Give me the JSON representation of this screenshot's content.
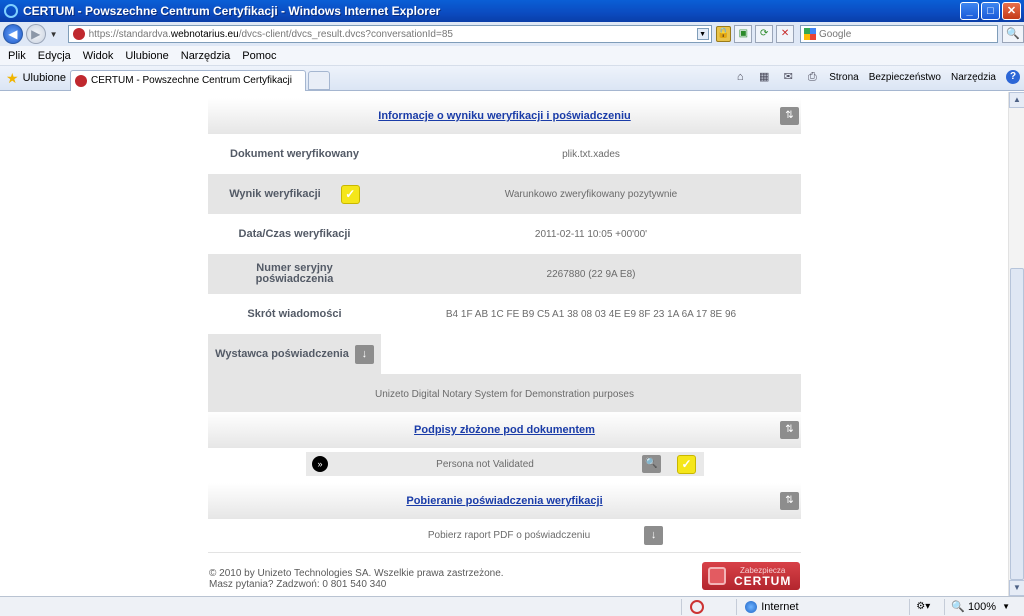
{
  "window": {
    "title": "CERTUM - Powszechne Centrum Certyfikacji - Windows Internet Explorer"
  },
  "address": {
    "url_prefix": "https://standardva.",
    "url_domain": "webnotarius.eu",
    "url_path": "/dvcs-client/dvcs_result.dvcs?conversationId=85",
    "search_placeholder": "Google"
  },
  "menu": [
    "Plik",
    "Edycja",
    "Widok",
    "Ulubione",
    "Narzędzia",
    "Pomoc"
  ],
  "tabs": {
    "favorites_label": "Ulubione",
    "active_tab": "CERTUM - Powszechne Centrum Certyfikacji"
  },
  "commandbar": {
    "page": "Strona",
    "safety": "Bezpieczeństwo",
    "tools": "Narzędzia"
  },
  "verification": {
    "header": "Informacje o wyniku weryfikacji i poświadczeniu",
    "rows": [
      {
        "label": "Dokument weryfikowany",
        "value": "plik.txt.xades"
      },
      {
        "label": "Wynik weryfikacji",
        "value": "Warunkowo zweryfikowany pozytywnie"
      },
      {
        "label": "Data/Czas weryfikacji",
        "value": "2011-02-11 10:05 +00'00'"
      },
      {
        "label": "Numer seryjny poświadczenia",
        "value": "2267880 (22 9A E8)"
      },
      {
        "label": "Skrót wiadomości",
        "value": "B4 1F AB 1C FE B9 C5 A1 38 08 03 4E E9 8F 23 1A 6A 17 8E 96"
      }
    ],
    "issuer_label": "Wystawca poświadczenia",
    "issuer_value": "Unizeto Digital Notary System for Demonstration purposes"
  },
  "signatures": {
    "header": "Podpisy złożone pod dokumentem",
    "persona": "Persona not Validated"
  },
  "download": {
    "header": "Pobieranie poświadczenia weryfikacji",
    "report_label": "Pobierz raport PDF o poświadczeniu"
  },
  "footer": {
    "copyright": "© 2010 by Unizeto Technologies SA. Wszelkie prawa zastrzeżone.",
    "contact": "Masz pytania? Zadzwoń: 0 801 540 340",
    "badge_top": "Zabezpiecza",
    "badge_bottom": "CERTUM"
  },
  "statusbar": {
    "zone": "Internet",
    "zoom": "100%"
  }
}
